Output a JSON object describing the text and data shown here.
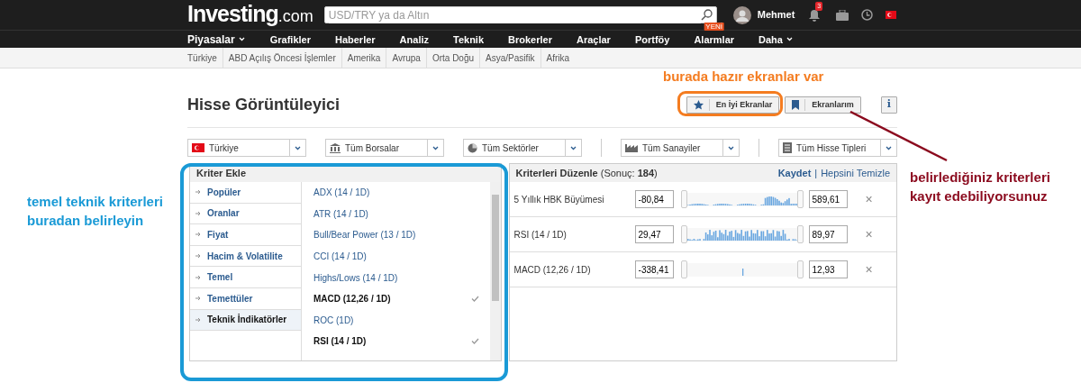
{
  "header": {
    "logo": {
      "name": "Investing",
      "suffix": ".com"
    },
    "search": {
      "placeholder": "USD/TRY ya da Altın"
    },
    "user": "Mehmet",
    "notifications": "3"
  },
  "nav": [
    {
      "label": "Piyasalar",
      "dropdown": true
    },
    {
      "label": "Grafikler",
      "dropdown": false
    },
    {
      "label": "Haberler",
      "dropdown": false
    },
    {
      "label": "Analiz",
      "dropdown": false
    },
    {
      "label": "Teknik",
      "dropdown": false
    },
    {
      "label": "Brokerler",
      "dropdown": false
    },
    {
      "label": "Araçlar",
      "dropdown": false
    },
    {
      "label": "Portföy",
      "dropdown": false
    },
    {
      "label": "Alarmlar",
      "dropdown": false,
      "badge": "YENİ"
    },
    {
      "label": "Daha",
      "dropdown": true
    }
  ],
  "subnav": [
    "Türkiye",
    "ABD Açılış Öncesi İşlemler",
    "Amerika",
    "Avrupa",
    "Orta Doğu",
    "Asya/Pasifik",
    "Afrika"
  ],
  "page_title": "Hisse Görüntüleyici",
  "buttons": [
    {
      "label": "En İyi Ekranlar",
      "kind": "star"
    },
    {
      "label": "Ekranlarım",
      "kind": "bookmark"
    },
    {
      "label": "i",
      "kind": "info"
    }
  ],
  "filters": [
    {
      "label": "Türkiye",
      "kind": "flag"
    },
    {
      "label": "Tüm Borsalar",
      "kind": "bank"
    },
    {
      "label": "Tüm Sektörler",
      "kind": "pie"
    },
    {
      "label": "Tüm Sanayiler",
      "kind": "factory"
    },
    {
      "label": "Tüm Hisse Tipleri",
      "kind": "doc"
    }
  ],
  "add_panel": {
    "title": "Kriter Ekle",
    "categories": [
      {
        "label": "Popüler",
        "selected": false
      },
      {
        "label": "Oranlar",
        "selected": false
      },
      {
        "label": "Fiyat",
        "selected": false
      },
      {
        "label": "Hacim & Volatilite",
        "selected": false
      },
      {
        "label": "Temel",
        "selected": false
      },
      {
        "label": "Temettüler",
        "selected": false
      },
      {
        "label": "Teknik İndikatörler",
        "selected": true
      }
    ],
    "criteria": [
      {
        "label": "ADX (14 / 1D)",
        "checked": false
      },
      {
        "label": "ATR (14 / 1D)",
        "checked": false
      },
      {
        "label": "Bull/Bear Power (13 / 1D)",
        "checked": false
      },
      {
        "label": "CCI (14 / 1D)",
        "checked": false
      },
      {
        "label": "Highs/Lows (14 / 1D)",
        "checked": false
      },
      {
        "label": "MACD (12,26 / 1D)",
        "checked": true
      },
      {
        "label": "ROC (1D)",
        "checked": false
      },
      {
        "label": "RSI (14 / 1D)",
        "checked": true
      }
    ]
  },
  "edit_panel": {
    "title": "**Kriterleri Düzenle** (Sonuç: **184**)",
    "save": "Kaydet",
    "separator": "|",
    "clear": "Hepsini Temizle",
    "rows": [
      {
        "name": "5 Yıllık HBK Büyümesi",
        "min": "-80,84",
        "max": "589,61",
        "remove": "×"
      },
      {
        "name": "RSI (14 / 1D)",
        "min": "29,47",
        "max": "89,97",
        "remove": "×"
      },
      {
        "name": "MACD (12,26 / 1D)",
        "min": "-338,41",
        "max": "12,93",
        "remove": "×"
      }
    ]
  },
  "annotations": [
    {
      "text": "burada hazır ekranlar var",
      "color": "#f47c20"
    },
    {
      "text": "temel teknik kriterleri buradan belirleyin",
      "color": "#1a9ad6"
    },
    {
      "text": "belirlediğiniz kriterleri kayıt edebiliyorsunuz",
      "color": "#8b0a1e"
    }
  ]
}
